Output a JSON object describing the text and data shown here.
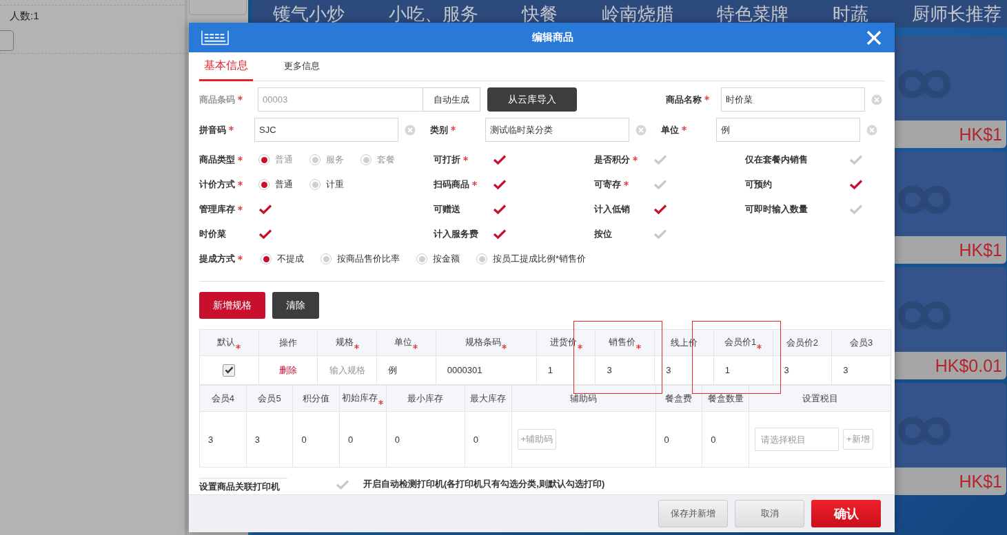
{
  "background": {
    "people_count": "人数:1",
    "categories": [
      "镬气小炒",
      "小吃、服务",
      "快餐",
      "岭南烧腊",
      "特色菜牌",
      "时蔬",
      "厨师长推荐"
    ],
    "cards": [
      {
        "price": "HK$1"
      },
      {
        "price": "HK$1"
      },
      {
        "price": "HK$0.01"
      },
      {
        "price": "HK$1"
      }
    ]
  },
  "dialog": {
    "title": "编辑商品",
    "tabs": [
      {
        "label": "基本信息",
        "selected": true
      },
      {
        "label": "更多信息",
        "selected": false
      }
    ],
    "form_rows": [
      [
        {
          "kind": "input",
          "label": "商品条码",
          "required": true,
          "disabled": true,
          "value": "00003",
          "addon": "自动生成"
        },
        {
          "kind": "button",
          "label": "从云库导入"
        },
        {
          "kind": "input",
          "label": "商品名称",
          "required": true,
          "disabled": false,
          "value": "时价菜",
          "clearable": true
        }
      ],
      [
        {
          "kind": "input",
          "label": "拼音码",
          "required": true,
          "disabled": false,
          "value": "SJC",
          "clearable": true
        },
        {
          "kind": "input",
          "label": "类别",
          "required": true,
          "disabled": false,
          "value": "测试临时菜分类",
          "clearable": true
        },
        {
          "kind": "input",
          "label": "单位",
          "required": true,
          "disabled": false,
          "value": "例",
          "clearable": true
        }
      ]
    ],
    "option_rows": [
      [
        {
          "kind": "radio",
          "label": "商品类型",
          "required": true,
          "disabled": true,
          "choices": [
            {
              "label": "普通",
              "selected": true
            },
            {
              "label": "服务",
              "selected": false
            },
            {
              "label": "套餐",
              "selected": false
            }
          ]
        },
        {
          "kind": "check",
          "label": "可打折",
          "required": true,
          "checked": true
        },
        {
          "kind": "check",
          "label": "是否积分",
          "required": true,
          "checked": false
        },
        {
          "kind": "check",
          "label": "仅在套餐内销售",
          "required": false,
          "checked": false
        }
      ],
      [
        {
          "kind": "radio",
          "label": "计价方式",
          "required": true,
          "disabled": false,
          "choices": [
            {
              "label": "普通",
              "selected": true
            },
            {
              "label": "计重",
              "selected": false
            }
          ]
        },
        {
          "kind": "check",
          "label": "扫码商品",
          "required": true,
          "checked": true
        },
        {
          "kind": "check",
          "label": "可寄存",
          "required": true,
          "checked": false
        },
        {
          "kind": "check",
          "label": "可预约",
          "required": false,
          "checked": true
        }
      ],
      [
        {
          "kind": "check",
          "label": "管理库存",
          "required": true,
          "checked": true
        },
        {
          "kind": "check",
          "label": "可赠送",
          "required": false,
          "checked": true
        },
        {
          "kind": "check",
          "label": "计入低销",
          "required": false,
          "checked": true
        },
        {
          "kind": "check",
          "label": "可即时输入数量",
          "required": false,
          "checked": false
        }
      ],
      [
        {
          "kind": "check",
          "label": "时价菜",
          "required": false,
          "checked": true
        },
        {
          "kind": "check",
          "label": "计入服务费",
          "required": false,
          "checked": true
        },
        {
          "kind": "check",
          "label": "按位",
          "required": false,
          "checked": false
        }
      ],
      [
        {
          "kind": "radio",
          "label": "提成方式",
          "required": true,
          "disabled": false,
          "choices": [
            {
              "label": "不提成",
              "selected": true
            },
            {
              "label": "按商品售价比率",
              "selected": false
            },
            {
              "label": "按金额",
              "selected": false
            },
            {
              "label": "按员工提成比例*销售价",
              "selected": false
            }
          ]
        }
      ]
    ],
    "spec_buttons": [
      {
        "label": "新增规格",
        "kind": "primary"
      },
      {
        "label": "清除",
        "kind": "dark"
      }
    ],
    "tables": [
      {
        "columns": [
          {
            "label": "默认",
            "required": true,
            "highlighted": false
          },
          {
            "label": "操作",
            "required": false,
            "highlighted": false
          },
          {
            "label": "规格",
            "required": true,
            "highlighted": false
          },
          {
            "label": "单位",
            "required": true,
            "highlighted": false
          },
          {
            "label": "规格条码",
            "required": true,
            "highlighted": false
          },
          {
            "label": "进货价",
            "required": true,
            "highlighted": false
          },
          {
            "label": "销售价",
            "required": true,
            "highlighted": true
          },
          {
            "label": "线上价",
            "required": false,
            "highlighted": false
          },
          {
            "label": "会员价1",
            "required": true,
            "highlighted": true
          },
          {
            "label": "会员价2",
            "required": false,
            "highlighted": false
          },
          {
            "label": "会员3",
            "required": false,
            "highlighted": false
          }
        ],
        "rows": [
          [
            {
              "kind": "check",
              "checked": true
            },
            {
              "kind": "link",
              "text": "删除"
            },
            {
              "kind": "input",
              "placeholder": "输入规格"
            },
            {
              "kind": "text",
              "text": "例"
            },
            {
              "kind": "text",
              "text": "0000301"
            },
            {
              "kind": "text",
              "text": "1"
            },
            {
              "kind": "text",
              "text": "3"
            },
            {
              "kind": "text",
              "text": "3"
            },
            {
              "kind": "text",
              "text": "1"
            },
            {
              "kind": "text",
              "text": "3"
            },
            {
              "kind": "text",
              "text": "3"
            }
          ]
        ]
      },
      {
        "columns": [
          {
            "label": "会员4",
            "required": false,
            "highlighted": false
          },
          {
            "label": "会员5",
            "required": false,
            "highlighted": false
          },
          {
            "label": "积分值",
            "required": false,
            "highlighted": false
          },
          {
            "label": "初始库存",
            "required": true,
            "highlighted": false
          },
          {
            "label": "最小库存",
            "required": false,
            "highlighted": false
          },
          {
            "label": "最大库存",
            "required": false,
            "highlighted": false
          },
          {
            "label": "辅助码",
            "required": false,
            "highlighted": false
          },
          {
            "label": "餐盒费",
            "required": false,
            "highlighted": false
          },
          {
            "label": "餐盒数量",
            "required": false,
            "highlighted": false
          },
          {
            "label": "设置税目",
            "required": false,
            "highlighted": false
          }
        ],
        "rows": [
          [
            {
              "kind": "text",
              "text": "3"
            },
            {
              "kind": "text",
              "text": "3"
            },
            {
              "kind": "text",
              "text": "0"
            },
            {
              "kind": "text",
              "text": "0"
            },
            {
              "kind": "text",
              "text": "0"
            },
            {
              "kind": "text",
              "text": "0"
            },
            {
              "kind": "button",
              "text": "+辅助码"
            },
            {
              "kind": "text",
              "text": "0"
            },
            {
              "kind": "text",
              "text": "0"
            },
            {
              "kind": "input_button",
              "placeholder": "请选择税目",
              "button": "+新增"
            }
          ]
        ]
      }
    ],
    "printer": {
      "label": "设置商品关联打印机",
      "auto_detect": {
        "label": "开启自动检测打印机(各打印机只有勾选分类,则默认勾选打印)",
        "checked": false
      }
    },
    "footer_buttons": [
      {
        "label": "保存并新增",
        "kind": "secondary"
      },
      {
        "label": "取消",
        "kind": "secondary"
      },
      {
        "label": "确认",
        "kind": "primary"
      }
    ]
  }
}
